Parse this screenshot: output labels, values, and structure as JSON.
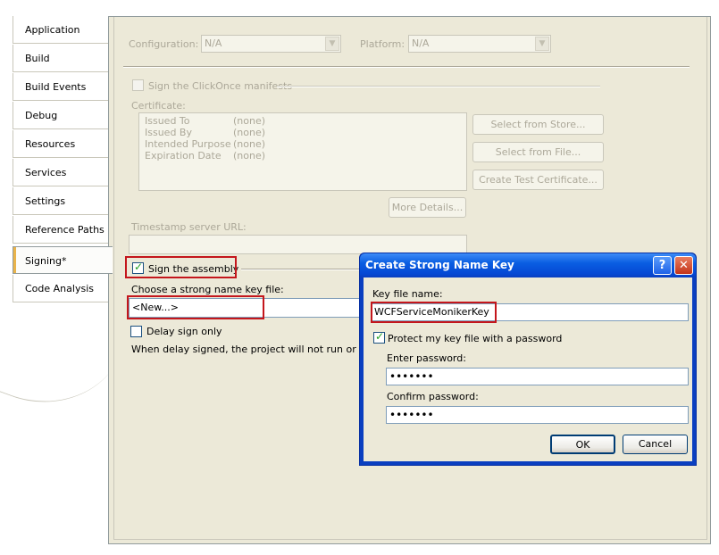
{
  "tabs": [
    {
      "label": "Application"
    },
    {
      "label": "Build"
    },
    {
      "label": "Build Events"
    },
    {
      "label": "Debug"
    },
    {
      "label": "Resources"
    },
    {
      "label": "Services"
    },
    {
      "label": "Settings"
    },
    {
      "label": "Reference Paths"
    },
    {
      "label": "Signing*"
    },
    {
      "label": "Code Analysis"
    }
  ],
  "signing": {
    "configuration_label": "Configuration:",
    "configuration_value": "N/A",
    "platform_label": "Platform:",
    "platform_value": "N/A",
    "clickonce_label": "Sign the ClickOnce manifests",
    "certificate_label": "Certificate:",
    "cert_fields": [
      {
        "key": "Issued To",
        "value": "(none)"
      },
      {
        "key": "Issued By",
        "value": "(none)"
      },
      {
        "key": "Intended Purpose",
        "value": "(none)"
      },
      {
        "key": "Expiration Date",
        "value": "(none)"
      }
    ],
    "select_store_btn": "Select from Store...",
    "select_file_btn": "Select from File...",
    "create_test_btn": "Create Test Certificate...",
    "more_details_btn": "More Details...",
    "timestamp_label": "Timestamp server URL:",
    "sign_assembly_label": "Sign the assembly",
    "key_file_label": "Choose a strong name key file:",
    "key_file_value": "<New...>",
    "delay_sign_label": "Delay sign only",
    "delay_note": "When delay signed, the project will not run or be debu"
  },
  "dialog": {
    "title": "Create Strong Name Key",
    "help_glyph": "?",
    "close_glyph": "✕",
    "key_file_name_label": "Key file name:",
    "key_file_name_value": "WCFServiceMonikerKey",
    "protect_label": "Protect my key file with a password",
    "enter_password_label": "Enter password:",
    "enter_password_value": "•••••••",
    "confirm_password_label": "Confirm password:",
    "confirm_password_value": "•••••••",
    "ok_label": "OK",
    "cancel_label": "Cancel"
  },
  "colors": {
    "highlight_box": "#c4161c",
    "dialog_title": "#0a5ee2",
    "panel_bg": "#ece9d8"
  },
  "icons": [
    "checkmark-icon",
    "dropdown-arrow-icon",
    "help-icon",
    "close-icon"
  ]
}
